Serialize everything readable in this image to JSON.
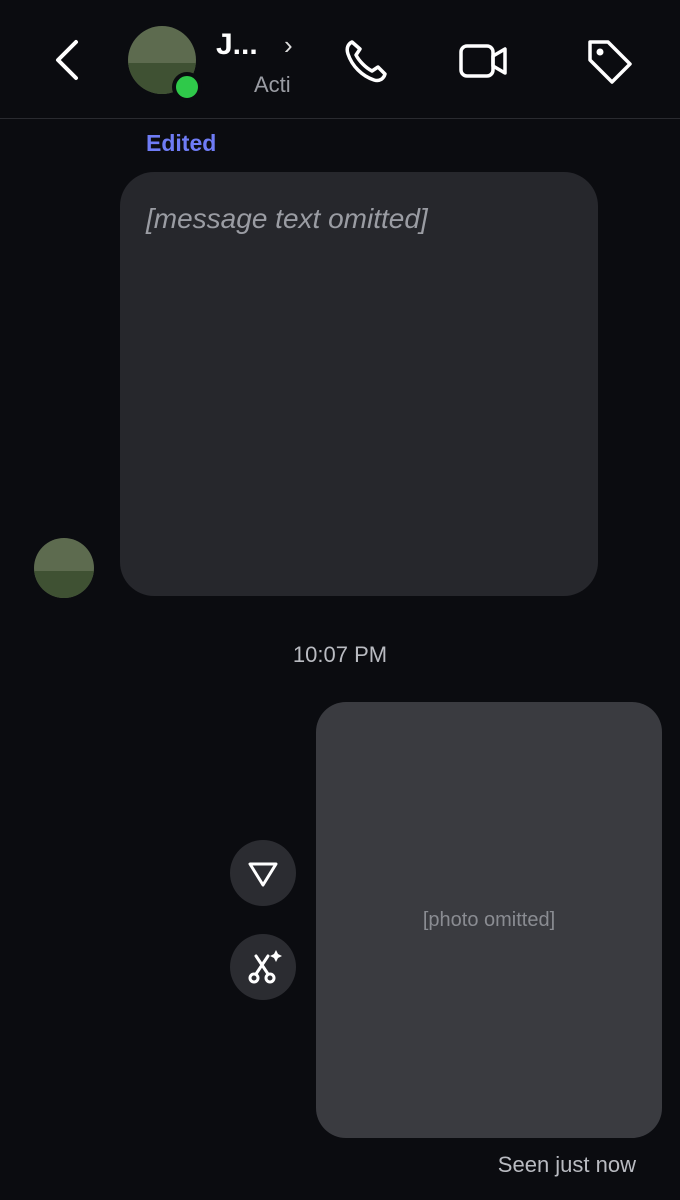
{
  "header": {
    "name": "J...",
    "status": "Acti",
    "chevron": "›",
    "icons": [
      "back-icon",
      "phone-icon",
      "video-icon",
      "tag-icon"
    ],
    "online_color": "#2fc94a"
  },
  "message": {
    "edited_label": "Edited",
    "placeholder": "[message text omitted]"
  },
  "timestamp": "10:07 PM",
  "photo": {
    "placeholder": "[photo omitted]"
  },
  "footer": {
    "seen": "Seen just now"
  },
  "colors": {
    "background": "#0b0c10",
    "bubble": "#26272c",
    "edited": "#6f7cf5"
  }
}
